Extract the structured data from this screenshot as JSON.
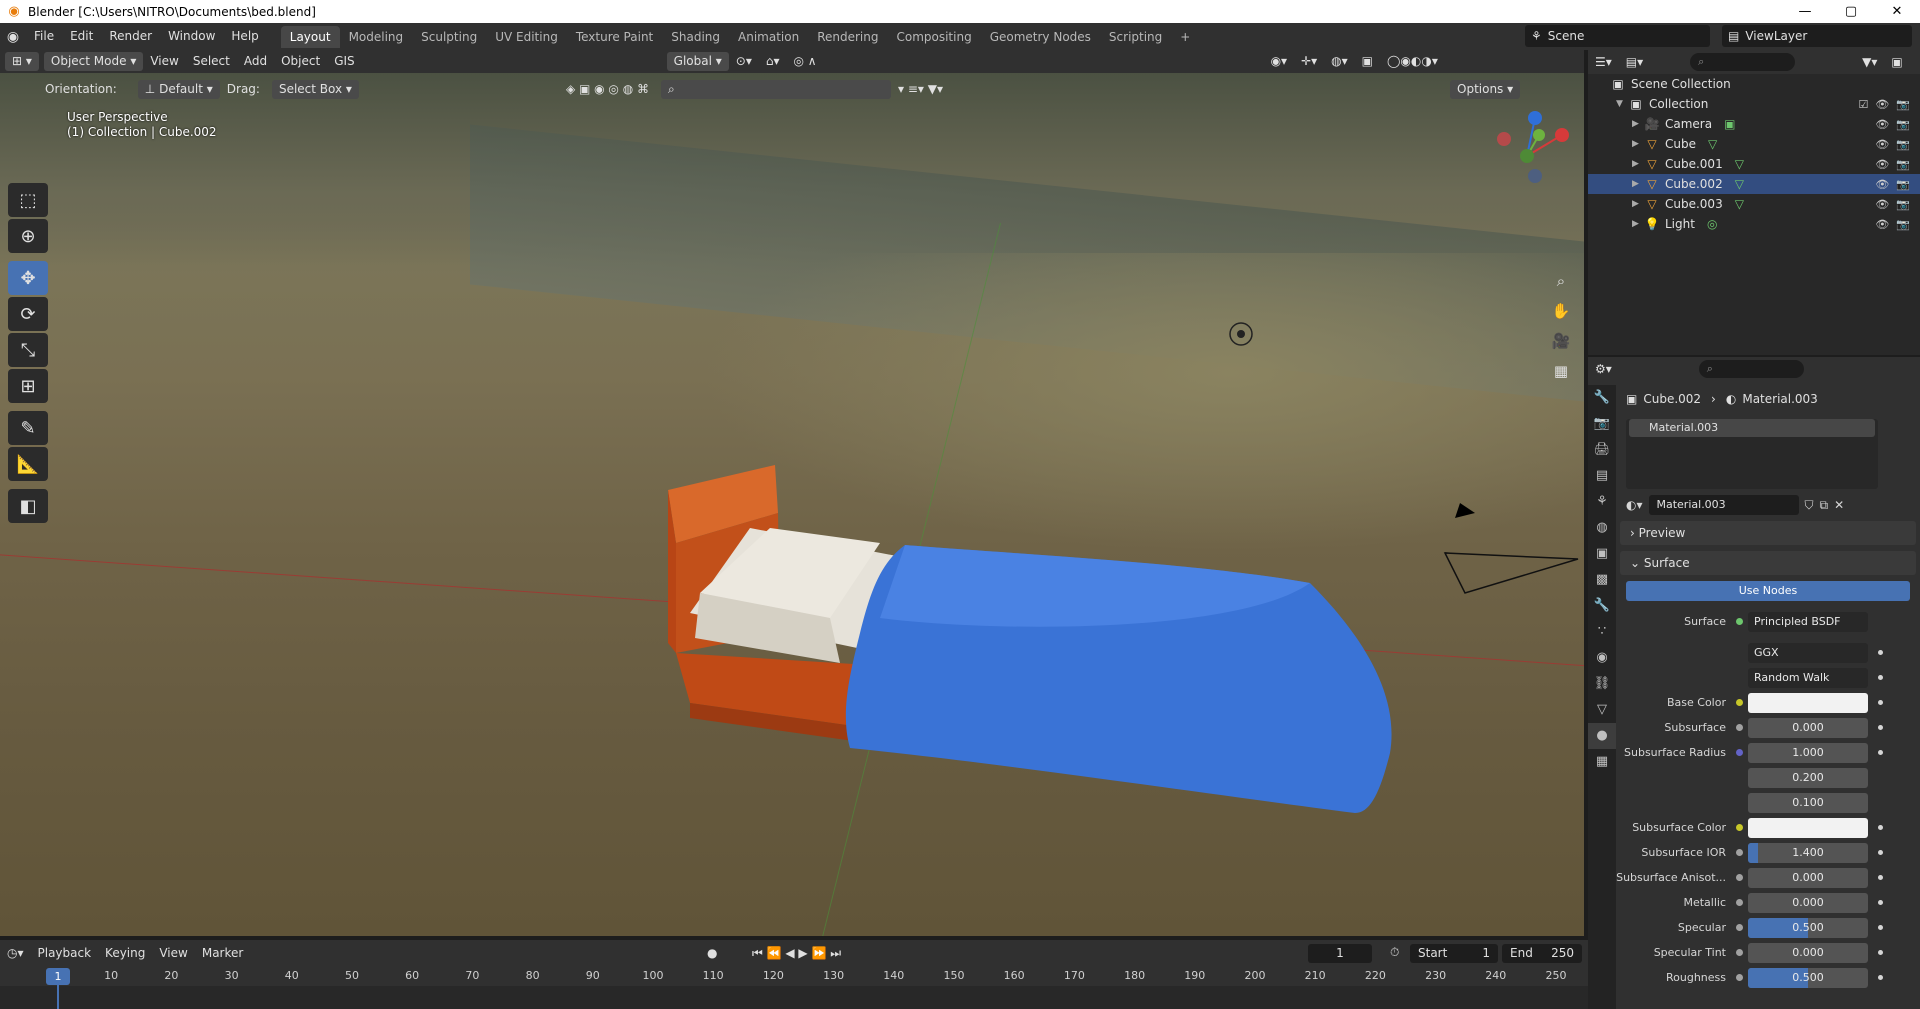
{
  "window": {
    "title": "Blender [C:\\Users\\NITRO\\Documents\\bed.blend]",
    "controls": [
      "—",
      "▢",
      "✕"
    ]
  },
  "menu": [
    "File",
    "Edit",
    "Render",
    "Window",
    "Help"
  ],
  "workspaces": [
    "Layout",
    "Modeling",
    "Sculpting",
    "UV Editing",
    "Texture Paint",
    "Shading",
    "Animation",
    "Rendering",
    "Compositing",
    "Geometry Nodes",
    "Scripting",
    "+"
  ],
  "active_workspace": "Layout",
  "scene": "Scene",
  "view_layer": "ViewLayer",
  "viewport_header": {
    "mode": "Object Mode",
    "menus": [
      "View",
      "Select",
      "Add",
      "Object",
      "GIS"
    ],
    "transform_orientation": "Global",
    "orientation_label": "Orientation:",
    "orientation_value": "Default",
    "drag_label": "Drag:",
    "drag_value": "Select Box",
    "options": "Options"
  },
  "viewport": {
    "perspective": "User Perspective",
    "collection_info": "(1) Collection | Cube.002"
  },
  "outliner": {
    "root": "Scene Collection",
    "collection": "Collection",
    "items": [
      {
        "name": "Camera",
        "icon": "camera-icon"
      },
      {
        "name": "Cube",
        "icon": "mesh-icon"
      },
      {
        "name": "Cube.001",
        "icon": "mesh-icon"
      },
      {
        "name": "Cube.002",
        "icon": "mesh-icon"
      },
      {
        "name": "Cube.003",
        "icon": "mesh-icon"
      },
      {
        "name": "Light",
        "icon": "light-icon"
      }
    ]
  },
  "properties": {
    "breadcrumb_object": "Cube.002",
    "breadcrumb_material": "Material.003",
    "slot": "Material.003",
    "material_name": "Material.003",
    "panels": {
      "preview": "Preview",
      "surface": "Surface"
    },
    "use_nodes": "Use Nodes",
    "surface_label": "Surface",
    "surface_shader": "Principled BSDF",
    "distribution": "GGX",
    "subsurface_method": "Random Walk",
    "rows": [
      {
        "label": "Base Color",
        "type": "color",
        "value": ""
      },
      {
        "label": "Subsurface",
        "type": "number",
        "value": "0.000"
      },
      {
        "label": "Subsurface Radius",
        "type": "number",
        "value": "1.000"
      },
      {
        "label": "",
        "type": "number",
        "value": "0.200"
      },
      {
        "label": "",
        "type": "number",
        "value": "0.100"
      },
      {
        "label": "Subsurface Color",
        "type": "color",
        "value": ""
      },
      {
        "label": "Subsurface IOR",
        "type": "slider",
        "value": "1.400",
        "fill": 0.08
      },
      {
        "label": "Subsurface Anisot...",
        "type": "number",
        "value": "0.000"
      },
      {
        "label": "Metallic",
        "type": "number",
        "value": "0.000"
      },
      {
        "label": "Specular",
        "type": "slider",
        "value": "0.500",
        "fill": 0.5
      },
      {
        "label": "Specular Tint",
        "type": "number",
        "value": "0.000"
      },
      {
        "label": "Roughness",
        "type": "slider",
        "value": "0.500",
        "fill": 0.5
      }
    ]
  },
  "timeline": {
    "menus": [
      "Playback",
      "Keying",
      "View",
      "Marker"
    ],
    "current_frame": "1",
    "start_label": "Start",
    "start": "1",
    "end_label": "End",
    "end": "250",
    "ticks": [
      "10",
      "20",
      "30",
      "40",
      "50",
      "60",
      "70",
      "80",
      "90",
      "100",
      "110",
      "120",
      "130",
      "140",
      "150",
      "160",
      "170",
      "180",
      "190",
      "200",
      "210",
      "220",
      "230",
      "240",
      "250"
    ],
    "ruler_current": "1"
  },
  "colors": {
    "accent": "#4772b3",
    "bed_frame": "#c04a16",
    "blanket": "#3a73d6"
  }
}
